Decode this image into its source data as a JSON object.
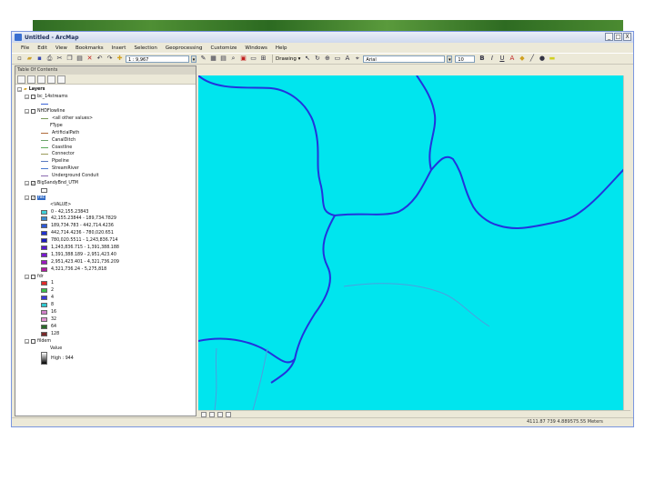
{
  "window": {
    "title": "Untitled - ArcMap",
    "buttons": {
      "minimize": "_",
      "maximize": "□",
      "close": "X"
    }
  },
  "menu": [
    "File",
    "Edit",
    "View",
    "Bookmarks",
    "Insert",
    "Selection",
    "Geoprocessing",
    "Customize",
    "Windows",
    "Help"
  ],
  "toolbar": {
    "scale": "1 : 9,967",
    "drawing_label": "Drawing ▾",
    "font": "Arial",
    "font_size": "10"
  },
  "toc": {
    "title": "Table Of Contents",
    "layers_root": "Layers",
    "entries": [
      {
        "kind": "layer",
        "label": "bc_14streams",
        "expander": "⊟",
        "checked": false
      },
      {
        "kind": "line",
        "label": "",
        "color": "#3b63d6"
      },
      {
        "kind": "layer",
        "label": "NHDFlowline",
        "expander": "⊟",
        "checked": false
      },
      {
        "kind": "line-text",
        "label": "<all other values>",
        "color": "#7a9a5a"
      },
      {
        "kind": "text",
        "label": "FType"
      },
      {
        "kind": "line",
        "label": "ArtificialPath",
        "color": "#b06a3a"
      },
      {
        "kind": "line",
        "label": "CanalDitch",
        "color": "#6aa36a"
      },
      {
        "kind": "line",
        "label": "Coastline",
        "color": "#5aaa5a"
      },
      {
        "kind": "line",
        "label": "Connector",
        "color": "#9a9a5a"
      },
      {
        "kind": "line",
        "label": "Pipeline",
        "color": "#5a7ac0"
      },
      {
        "kind": "line",
        "label": "StreamRiver",
        "color": "#4a7ad0"
      },
      {
        "kind": "line",
        "label": "Underground Conduit",
        "color": "#8a6ab0"
      },
      {
        "kind": "layer",
        "label": "BigSandyBnd_UTM",
        "expander": "⊟",
        "checked": true
      },
      {
        "kind": "swatch",
        "label": "",
        "color": "#ffffff"
      },
      {
        "kind": "layer",
        "label": "fac",
        "expander": "⊟",
        "checked": true,
        "selected": true
      },
      {
        "kind": "text",
        "label": "<VALUE>"
      },
      {
        "kind": "swatch",
        "label": "0 - 42,155.23843",
        "color": "#3fd0d8"
      },
      {
        "kind": "swatch",
        "label": "42,155.23844 - 189,734.7829",
        "color": "#3a8ad0"
      },
      {
        "kind": "swatch",
        "label": "189,734.783 - 442,714.4236",
        "color": "#2e5ad8"
      },
      {
        "kind": "swatch",
        "label": "442,714.4236 - 780,020.651",
        "color": "#2233d0"
      },
      {
        "kind": "swatch",
        "label": "780,020.5511 - 1,243,836.714",
        "color": "#1a1ac0"
      },
      {
        "kind": "swatch",
        "label": "1,243,836.715 - 1,391,388.188",
        "color": "#5a1ad0"
      },
      {
        "kind": "swatch",
        "label": "1,391,388.189 - 2,951,423.40",
        "color": "#7a1ad0"
      },
      {
        "kind": "swatch",
        "label": "2,951,423.401 - 4,321,736.209",
        "color": "#9a1ac0"
      },
      {
        "kind": "swatch",
        "label": "4,321,736.24 - 5,275,818",
        "color": "#b01aa0"
      },
      {
        "kind": "layer",
        "label": "fdr",
        "expander": "⊟",
        "checked": false
      },
      {
        "kind": "swatch",
        "label": "1",
        "color": "#e02a2a"
      },
      {
        "kind": "swatch",
        "label": "2",
        "color": "#3ac04a"
      },
      {
        "kind": "swatch",
        "label": "4",
        "color": "#3a3ad8"
      },
      {
        "kind": "swatch",
        "label": "8",
        "color": "#30c8d0"
      },
      {
        "kind": "swatch",
        "label": "16",
        "color": "#d080c8"
      },
      {
        "kind": "swatch",
        "label": "32",
        "color": "#e090d0"
      },
      {
        "kind": "swatch",
        "label": "64",
        "color": "#2a6a2a"
      },
      {
        "kind": "swatch",
        "label": "128",
        "color": "#7a2a2a"
      },
      {
        "kind": "layer",
        "label": "fildem",
        "expander": "⊟",
        "checked": false
      },
      {
        "kind": "text",
        "label": "Value"
      },
      {
        "kind": "ramp",
        "label": "High : 944"
      }
    ]
  },
  "statusbar": {
    "coords": "4111.87 739 4.889575.55 Meters"
  },
  "colors": {
    "map_background": "#00e5ee",
    "stream": "#2233dd",
    "stream_faint": "#4aa0e0"
  }
}
